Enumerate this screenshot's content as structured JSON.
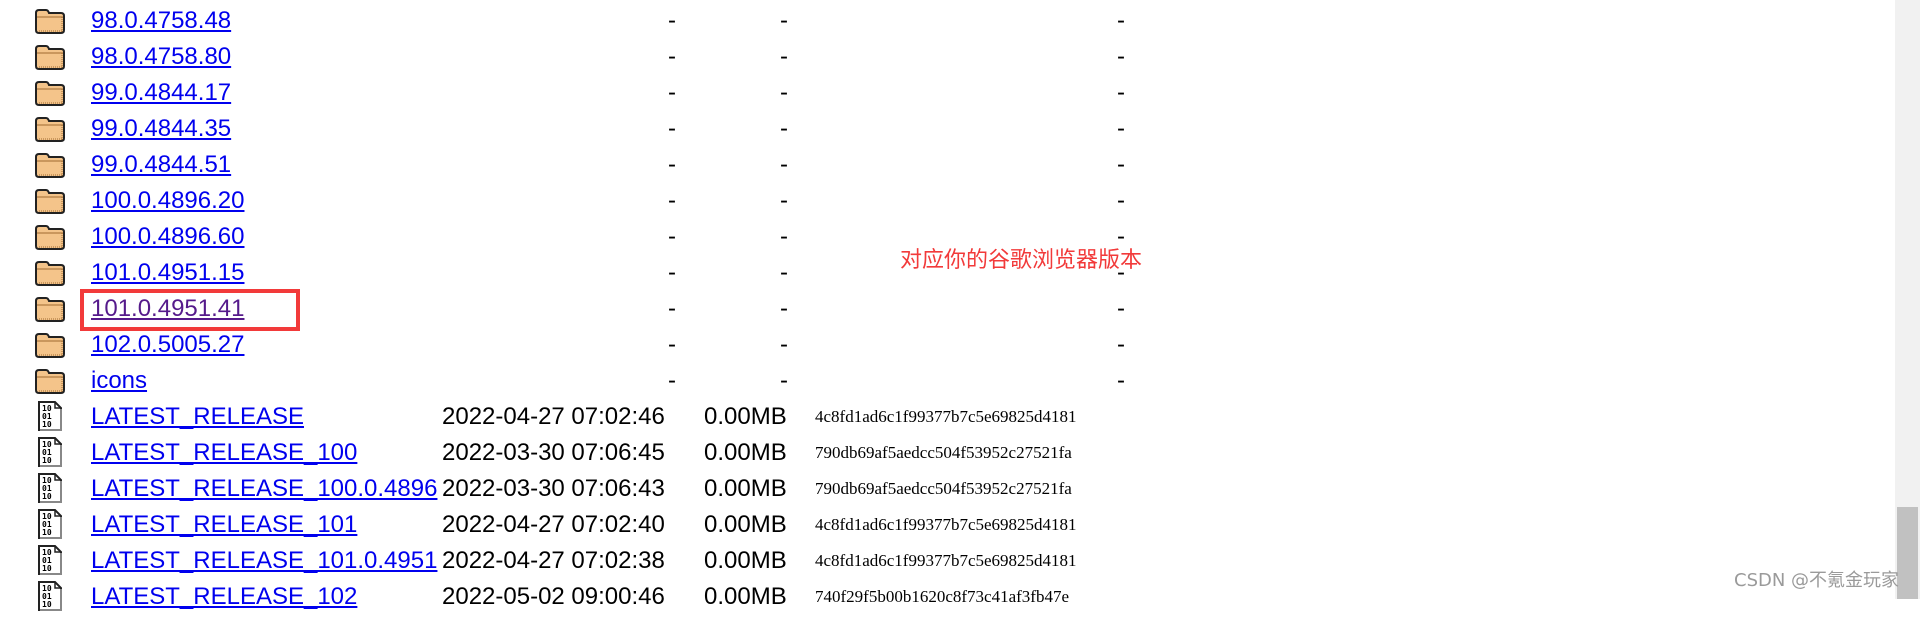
{
  "listing": [
    {
      "type": "folder",
      "name": "98.0.4758.48",
      "date": "-",
      "size": "-",
      "hash": "-"
    },
    {
      "type": "folder",
      "name": "98.0.4758.80",
      "date": "-",
      "size": "-",
      "hash": "-"
    },
    {
      "type": "folder",
      "name": "99.0.4844.17",
      "date": "-",
      "size": "-",
      "hash": "-"
    },
    {
      "type": "folder",
      "name": "99.0.4844.35",
      "date": "-",
      "size": "-",
      "hash": "-"
    },
    {
      "type": "folder",
      "name": "99.0.4844.51",
      "date": "-",
      "size": "-",
      "hash": "-"
    },
    {
      "type": "folder",
      "name": "100.0.4896.20",
      "date": "-",
      "size": "-",
      "hash": "-"
    },
    {
      "type": "folder",
      "name": "100.0.4896.60",
      "date": "-",
      "size": "-",
      "hash": "-"
    },
    {
      "type": "folder",
      "name": "101.0.4951.15",
      "date": "-",
      "size": "-",
      "hash": "-"
    },
    {
      "type": "folder",
      "name": "101.0.4951.41",
      "date": "-",
      "size": "-",
      "hash": "-",
      "visited": true
    },
    {
      "type": "folder",
      "name": "102.0.5005.27",
      "date": "-",
      "size": "-",
      "hash": "-"
    },
    {
      "type": "folder",
      "name": "icons",
      "date": "-",
      "size": "-",
      "hash": "-"
    },
    {
      "type": "file",
      "name": "LATEST_RELEASE",
      "date": "2022-04-27 07:02:46",
      "size": "0.00MB",
      "hash": "4c8fd1ad6c1f99377b7c5e69825d4181"
    },
    {
      "type": "file",
      "name": "LATEST_RELEASE_100",
      "date": "2022-03-30 07:06:45",
      "size": "0.00MB",
      "hash": "790db69af5aedcc504f53952c27521fa"
    },
    {
      "type": "file",
      "name": "LATEST_RELEASE_100.0.4896",
      "date": "2022-03-30 07:06:43",
      "size": "0.00MB",
      "hash": "790db69af5aedcc504f53952c27521fa"
    },
    {
      "type": "file",
      "name": "LATEST_RELEASE_101",
      "date": "2022-04-27 07:02:40",
      "size": "0.00MB",
      "hash": "4c8fd1ad6c1f99377b7c5e69825d4181"
    },
    {
      "type": "file",
      "name": "LATEST_RELEASE_101.0.4951",
      "date": "2022-04-27 07:02:38",
      "size": "0.00MB",
      "hash": "4c8fd1ad6c1f99377b7c5e69825d4181"
    },
    {
      "type": "file",
      "name": "LATEST_RELEASE_102",
      "date": "2022-05-02 09:00:46",
      "size": "0.00MB",
      "hash": "740f29f5b00b1620c8f73c41af3fb47e"
    }
  ],
  "annotation": {
    "text": "对应你的谷歌浏览器版本",
    "color": "#f23a3a"
  },
  "watermark": "CSDN @不氪金玩家",
  "colors": {
    "link": "#0000ee",
    "visited": "#551a8b",
    "highlight": "#f23a3a"
  }
}
